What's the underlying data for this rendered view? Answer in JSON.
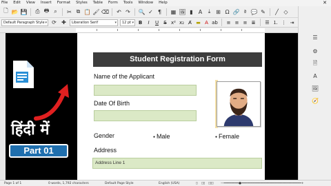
{
  "menu": [
    "File",
    "Edit",
    "View",
    "Insert",
    "Format",
    "Styles",
    "Table",
    "Form",
    "Tools",
    "Window",
    "Help"
  ],
  "toolbar2": {
    "paragraph_style": "Default Paragraph Style",
    "font_name": "Liberation Serif",
    "font_size": "12 pt"
  },
  "overlay": {
    "hindi_text": "हिंदी में",
    "part_label": "Part 01"
  },
  "form": {
    "title": "Student Registration Form",
    "name_label": "Name of the Applicant",
    "dob_label": "Date Of Birth",
    "gender_label": "Gender",
    "male_label": "Male",
    "female_label": "Female",
    "address_label": "Address",
    "address_line1": "Address Line 1"
  },
  "status": {
    "page": "Page 1 of 1",
    "words": "0 words, 1,792 characters",
    "page_style": "Default Page Style",
    "language": "English (USA)"
  },
  "colors": {
    "field_bg": "#dbe9c6",
    "title_bg": "#3d3d3d",
    "part_bg": "#1f6fae",
    "arrow": "#e02020"
  }
}
